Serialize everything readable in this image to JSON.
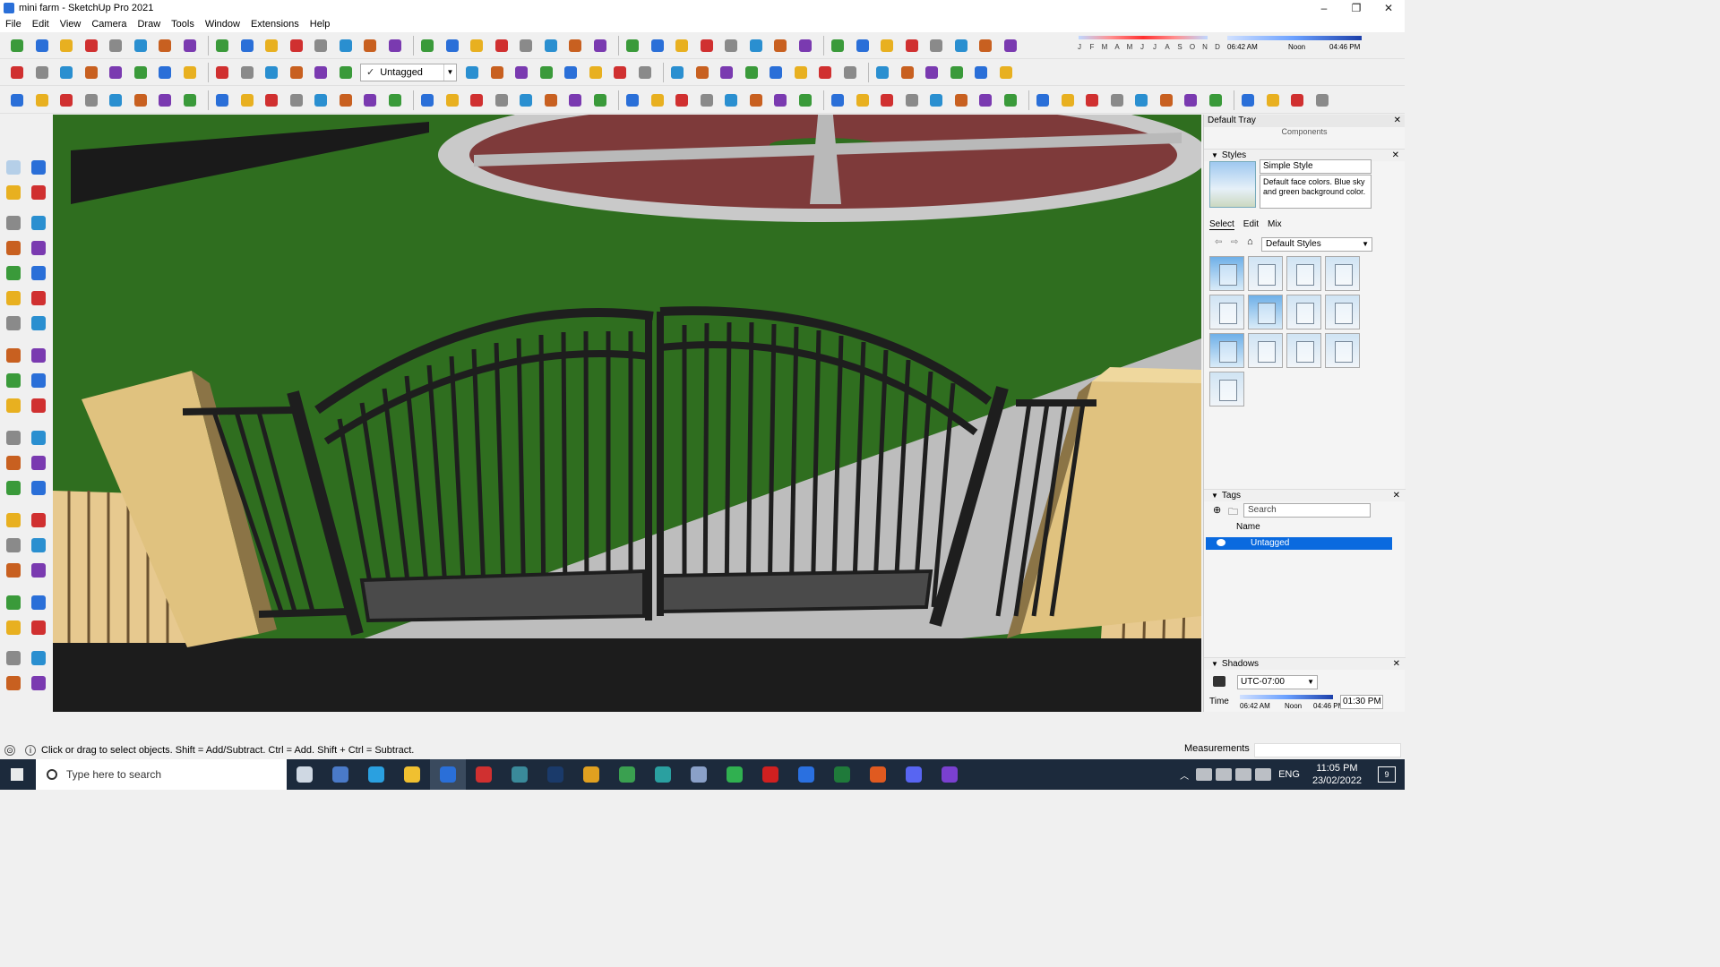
{
  "window": {
    "title": "mini farm - SketchUp Pro 2021",
    "controls": [
      "–",
      "❐",
      "✕"
    ]
  },
  "menu": [
    "File",
    "Edit",
    "View",
    "Camera",
    "Draw",
    "Tools",
    "Window",
    "Extensions",
    "Help"
  ],
  "toolbar": {
    "tag_select": "Untagged",
    "tag_check": "✓"
  },
  "shadow_toolbar": {
    "months": [
      "J",
      "F",
      "M",
      "A",
      "M",
      "J",
      "J",
      "A",
      "S",
      "O",
      "N",
      "D"
    ],
    "time_start": "06:42 AM",
    "time_mid": "Noon",
    "time_end": "04:46 PM"
  },
  "tray": {
    "title": "Default Tray",
    "components_label": "Components",
    "styles": {
      "header": "Styles",
      "style_name": "Simple Style",
      "style_desc": "Default face colors. Blue sky and green background color.",
      "tabs": [
        "Select",
        "Edit",
        "Mix"
      ],
      "library": "Default Styles"
    },
    "tags": {
      "header": "Tags",
      "search_placeholder": "Search",
      "column_name": "Name",
      "row": "Untagged"
    },
    "shadows": {
      "header": "Shadows",
      "timezone": "UTC-07:00",
      "time_label": "Time",
      "time_start": "06:42 AM",
      "time_mid": "Noon",
      "time_end": "04:46 PM",
      "time_value": "01:30 PM"
    }
  },
  "status": {
    "hint": "Click or drag to select objects. Shift = Add/Subtract. Ctrl = Add. Shift + Ctrl = Subtract.",
    "measurements_label": "Measurements"
  },
  "taskbar": {
    "search_placeholder": "Type here to search",
    "time": "11:05 PM",
    "date": "23/02/2022",
    "lang": "ENG",
    "notifications": "9"
  },
  "colors": {
    "grass": "#2f6e1f",
    "path": "#b7b7b7",
    "pillar": "#d9b86c",
    "gate": "#1e1e1e",
    "brick": "#8a3f3f",
    "selection_blue": "#0a6adf"
  }
}
